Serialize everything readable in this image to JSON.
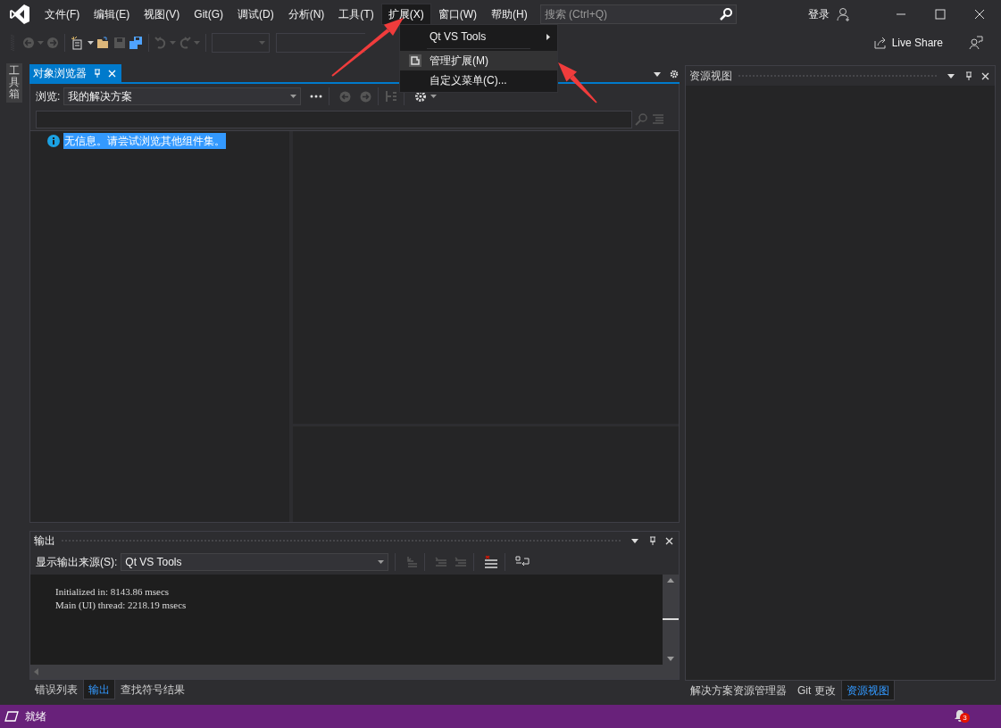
{
  "window": {
    "menu": [
      {
        "label": "文件(F)",
        "selected": false
      },
      {
        "label": "编辑(E)",
        "selected": false
      },
      {
        "label": "视图(V)",
        "selected": false
      },
      {
        "label": "Git(G)",
        "selected": false
      },
      {
        "label": "调试(D)",
        "selected": false
      },
      {
        "label": "分析(N)",
        "selected": false
      },
      {
        "label": "工具(T)",
        "selected": false
      },
      {
        "label": "扩展(X)",
        "selected": true
      },
      {
        "label": "窗口(W)",
        "selected": false
      },
      {
        "label": "帮助(H)",
        "selected": false
      }
    ],
    "search": {
      "placeholder": "搜索 (Ctrl+Q)"
    },
    "sign_in": "登录"
  },
  "toolbar": {
    "live_share": "Live Share"
  },
  "toolbox_tab": "工具箱",
  "dropdown_menu": {
    "items": [
      {
        "kind": "submenu",
        "label": "Qt VS Tools",
        "selected": false
      },
      {
        "kind": "item",
        "label": "管理扩展(M)",
        "selected": true
      },
      {
        "kind": "item",
        "label": "自定义菜单(C)...",
        "selected": false
      }
    ]
  },
  "object_browser": {
    "tab": "对象浏览器",
    "browse_label": "浏览:",
    "browse_value": "我的解决方案",
    "message": "无信息。请尝试浏览其他组件集。"
  },
  "output": {
    "title": "输出",
    "source_label": "显示输出来源(S):",
    "source_value": "Qt VS Tools",
    "lines": [
      "Initialized in: 8143.86 msecs",
      "Main (UI) thread: 2218.19 msecs"
    ]
  },
  "bottom_tabs": [
    {
      "label": "错误列表",
      "selected": false
    },
    {
      "label": "输出",
      "selected": true
    },
    {
      "label": "查找符号结果",
      "selected": false
    }
  ],
  "resource_view": {
    "title": "资源视图",
    "tabs": [
      {
        "label": "解决方案资源管理器",
        "selected": false
      },
      {
        "label": "Git 更改",
        "selected": false
      },
      {
        "label": "资源视图",
        "selected": true
      }
    ]
  },
  "status_bar": {
    "text": "就绪",
    "notifications": "3"
  }
}
